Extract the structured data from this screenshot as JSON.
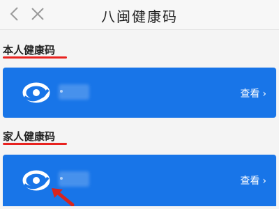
{
  "header": {
    "title": "八闽健康码",
    "back_icon": "chevron-left-icon",
    "close_icon": "close-icon"
  },
  "sections": [
    {
      "label": "本人健康码",
      "action_label": "查看"
    },
    {
      "label": "家人健康码",
      "action_label": "查看"
    }
  ],
  "colors": {
    "card_blue": "#1875e8",
    "underline_red": "#e8221f",
    "annotation_arrow": "#d7241e"
  },
  "icons": {
    "logo": "health-code-logo-icon",
    "chevron": "chevron-right-icon",
    "annotation": "annotation-arrow-icon"
  }
}
